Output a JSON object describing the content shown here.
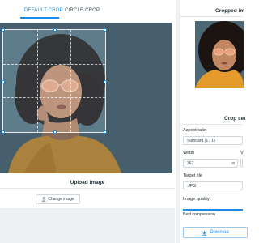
{
  "tabs": {
    "default_crop": "DEFAULT CROP",
    "circle_crop": "CIRCLE CROP"
  },
  "upload": {
    "title": "Upload image",
    "change_button": "Change image"
  },
  "result": {
    "title": "Cropped im"
  },
  "settings": {
    "title": "Crop set",
    "aspect_ratio_label": "Aspect ratio",
    "aspect_ratio_value": "Standard (1 / 1)",
    "width_label": "Width",
    "width_value": "367",
    "width_unit": "px",
    "height_label_partial": "V",
    "target_file_label": "Target file",
    "target_file_value": ".JPG",
    "image_quality_label": "Image quality",
    "quality_value": "Best compression",
    "download_button": "Downloa"
  },
  "icons": {
    "upload": "upload-icon",
    "download": "download-icon",
    "dropdown": "chevron-down-icon"
  },
  "colors": {
    "accent": "#1e88e5",
    "canvas_bg": "#4a6572"
  }
}
